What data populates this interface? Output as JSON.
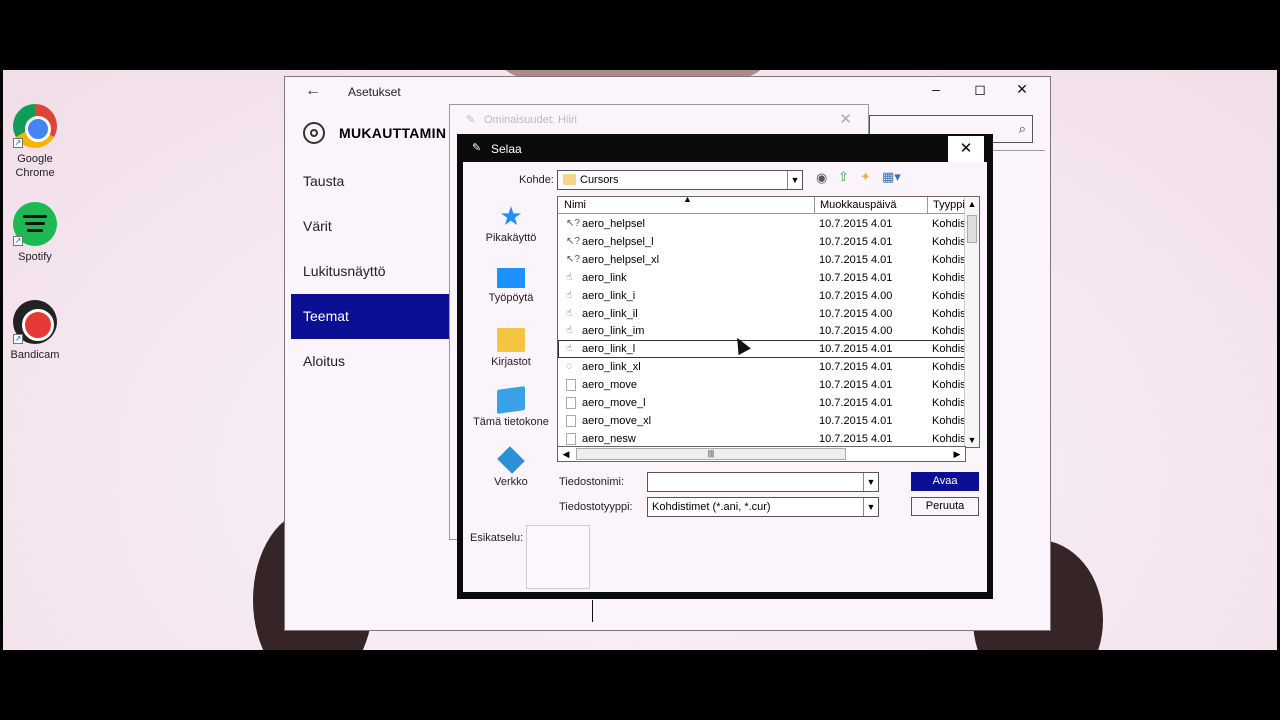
{
  "desktop": {
    "icons": [
      {
        "label": "Google\nChrome",
        "label1": "Google",
        "label2": "Chrome"
      },
      {
        "label1": "Spotify"
      },
      {
        "label1": "Bandicam"
      }
    ]
  },
  "settings": {
    "title": "Asetukset",
    "heading": "MUKAUTTAMIN",
    "nav": [
      "Tausta",
      "Värit",
      "Lukitusnäyttö",
      "Teemat",
      "Aloitus"
    ],
    "active_nav": "Teemat"
  },
  "mouse_dialog": {
    "title": "Ominaisuudet: Hiiri"
  },
  "browse_dialog": {
    "title": "Selaa",
    "location_label": "Kohde:",
    "location_value": "Cursors",
    "places": [
      "Pikakäyttö",
      "Työpöytä",
      "Kirjastot",
      "Tämä tietokone",
      "Verkko"
    ],
    "columns": [
      "Nimi",
      "Muokkauspäivä",
      "Tyyppi"
    ],
    "files": [
      {
        "name": "aero_helpsel",
        "date": "10.7.2015 4.01",
        "type": "Kohdistin"
      },
      {
        "name": "aero_helpsel_l",
        "date": "10.7.2015 4.01",
        "type": "Kohdistin"
      },
      {
        "name": "aero_helpsel_xl",
        "date": "10.7.2015 4.01",
        "type": "Kohdistin"
      },
      {
        "name": "aero_link",
        "date": "10.7.2015 4.01",
        "type": "Kohdistin"
      },
      {
        "name": "aero_link_i",
        "date": "10.7.2015 4.00",
        "type": "Kohdistin"
      },
      {
        "name": "aero_link_il",
        "date": "10.7.2015 4.00",
        "type": "Kohdistin"
      },
      {
        "name": "aero_link_im",
        "date": "10.7.2015 4.00",
        "type": "Kohdistin"
      },
      {
        "name": "aero_link_l",
        "date": "10.7.2015 4.01",
        "type": "Kohdistin"
      },
      {
        "name": "aero_link_xl",
        "date": "10.7.2015 4.01",
        "type": "Kohdistin"
      },
      {
        "name": "aero_move",
        "date": "10.7.2015 4.01",
        "type": "Kohdistin"
      },
      {
        "name": "aero_move_l",
        "date": "10.7.2015 4.01",
        "type": "Kohdistin"
      },
      {
        "name": "aero_move_xl",
        "date": "10.7.2015 4.01",
        "type": "Kohdistin"
      },
      {
        "name": "aero_nesw",
        "date": "10.7.2015 4.01",
        "type": "Kohdistin"
      }
    ],
    "selected_file": "aero_link_l",
    "filename_label": "Tiedostonimi:",
    "filename_value": "",
    "filetype_label": "Tiedostotyyppi:",
    "filetype_value": "Kohdistimet (*.ani, *.cur)",
    "open_button": "Avaa",
    "cancel_button": "Peruuta",
    "preview_label": "Esikatselu:"
  },
  "colors": {
    "accent": "#0a0f94",
    "window_bg": "#fbf4fa"
  }
}
